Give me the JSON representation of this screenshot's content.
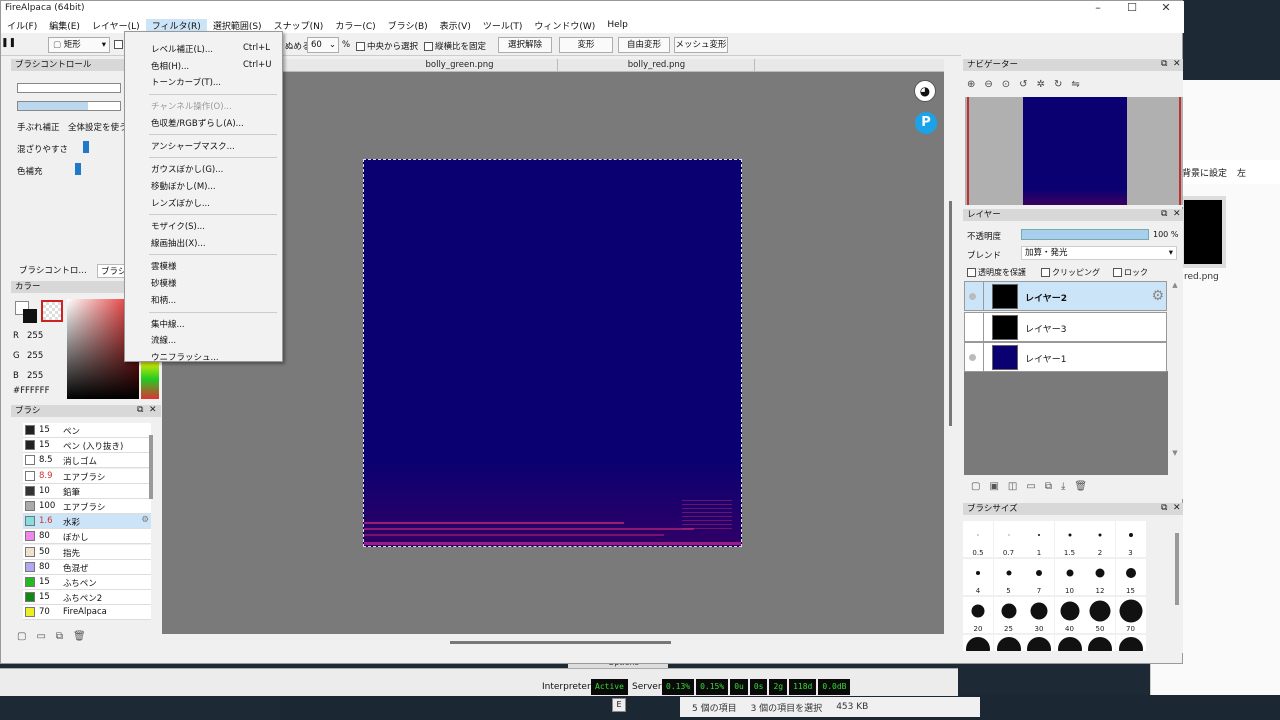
{
  "window": {
    "title": "FireAlpaca (64bit)"
  },
  "menubar": [
    "イル(F)",
    "編集(E)",
    "レイヤー(L)",
    "フィルタ(R)",
    "選択範囲(S)",
    "スナップ(N)",
    "カラー(C)",
    "ブラシ(B)",
    "表示(V)",
    "ツール(T)",
    "ウィンドウ(W)",
    "Help"
  ],
  "toolbar": {
    "shape_select": "矩形",
    "bleed_label": "ぬめる",
    "bleed_value": "60",
    "percent": "%",
    "center_select": "中央から選択",
    "fix_ratio": "縦横比を固定",
    "deselect": "選択解除",
    "transform": "変形",
    "free_transform": "自由変形",
    "mesh_transform": "メッシュ変形"
  },
  "filter_menu": {
    "items": [
      {
        "label": "レベル補正(L)...",
        "shortcut": "Ctrl+L",
        "enabled": true
      },
      {
        "label": "色相(H)...",
        "shortcut": "Ctrl+U",
        "enabled": true
      },
      {
        "label": "トーンカーブ(T)...",
        "shortcut": "",
        "enabled": true
      },
      {
        "label": "チャンネル操作(O)...",
        "shortcut": "",
        "enabled": false
      },
      {
        "label": "色収差/RGBずらし(A)...",
        "shortcut": "",
        "enabled": true
      },
      {
        "label": "アンシャープマスク...",
        "shortcut": "",
        "enabled": true
      },
      {
        "label": "ガウスぼかし(G)...",
        "shortcut": "",
        "enabled": true
      },
      {
        "label": "移動ぼかし(M)...",
        "shortcut": "",
        "enabled": true
      },
      {
        "label": "レンズぼかし...",
        "shortcut": "",
        "enabled": true
      },
      {
        "label": "モザイク(S)...",
        "shortcut": "",
        "enabled": true
      },
      {
        "label": "線画抽出(X)...",
        "shortcut": "",
        "enabled": true
      },
      {
        "label": "雲模様",
        "shortcut": "",
        "enabled": true
      },
      {
        "label": "砂模様",
        "shortcut": "",
        "enabled": true
      },
      {
        "label": "和柄...",
        "shortcut": "",
        "enabled": true
      },
      {
        "label": "集中線...",
        "shortcut": "",
        "enabled": true
      },
      {
        "label": "流線...",
        "shortcut": "",
        "enabled": true
      },
      {
        "label": "ウニフラッシュ...",
        "shortcut": "",
        "enabled": true
      }
    ]
  },
  "brush_control": {
    "title": "ブラシコントロール",
    "stabilizer": "手ぶれ補正",
    "global_setting": "全体設定を使う",
    "mixing": "混ざりやすさ",
    "color_supplement": "色補充",
    "tab1": "ブラシコントロ…",
    "tab2": "ブラシフ"
  },
  "color_panel": {
    "title": "カラー",
    "r_label": "R",
    "g_label": "G",
    "b_label": "B",
    "r": "255",
    "g": "255",
    "b": "255",
    "hex": "#FFFFFF"
  },
  "brush_panel": {
    "title": "ブラシ",
    "items": [
      {
        "size": "15",
        "name": "ペン",
        "color": "#222222"
      },
      {
        "size": "15",
        "name": "ペン (入り抜き)",
        "color": "#222222"
      },
      {
        "size": "8.5",
        "name": "消しゴム",
        "color": "#ffffff"
      },
      {
        "size": "8.9",
        "name": "エアブラシ",
        "color": "#ffffff"
      },
      {
        "size": "10",
        "name": "鉛筆",
        "color": "#333333"
      },
      {
        "size": "100",
        "name": "エアブラシ",
        "color": "#aaaaaa"
      },
      {
        "size": "1.6",
        "name": "水彩",
        "color": "#88dddd"
      },
      {
        "size": "80",
        "name": "ぼかし",
        "color": "#ee88ee"
      },
      {
        "size": "50",
        "name": "指先",
        "color": "#f0e0d0"
      },
      {
        "size": "80",
        "name": "色混ぜ",
        "color": "#b0a8f0"
      },
      {
        "size": "15",
        "name": "ふちペン",
        "color": "#22bb22"
      },
      {
        "size": "15",
        "name": "ふちペン2",
        "color": "#118811"
      },
      {
        "size": "70",
        "name": "FireAlpaca",
        "color": "#eeee22"
      }
    ]
  },
  "tabs": [
    "bolly_green.png",
    "bolly_red.png"
  ],
  "navigator": {
    "title": "ナビゲーター"
  },
  "layer_panel": {
    "title": "レイヤー",
    "opacity_label": "不透明度",
    "opacity_value": "100 %",
    "blend_label": "ブレンド",
    "blend_value": "加算・発光",
    "protect_alpha": "透明度を保護",
    "clipping": "クリッピング",
    "lock": "ロック",
    "layers": [
      {
        "name": "レイヤー2",
        "thumb": "#000000"
      },
      {
        "name": "レイヤー3",
        "thumb": "#000000"
      },
      {
        "name": "レイヤー1",
        "thumb": "#0a0072"
      }
    ]
  },
  "brush_size": {
    "title": "ブラシサイズ",
    "sizes": [
      "0.5",
      "0.7",
      "1",
      "1.5",
      "2",
      "3",
      "4",
      "5",
      "7",
      "10",
      "12",
      "15",
      "20",
      "25",
      "30",
      "40",
      "50",
      "70"
    ]
  },
  "status": {
    "interpreter_label": "Interpreter:",
    "interpreter_value": "Active",
    "server_label": "Server:",
    "meters": [
      "0.13%",
      "0.15%",
      "0u",
      "0s",
      "2g",
      "118d",
      "0.0dB"
    ],
    "options": "Options",
    "key_e": "E"
  },
  "explorer": {
    "items": "5 個の項目",
    "selected": "3 個の項目を選択",
    "size": "453 KB",
    "set_bg": "背景に設定",
    "rotate": "左",
    "thumb_name": "red.png"
  }
}
